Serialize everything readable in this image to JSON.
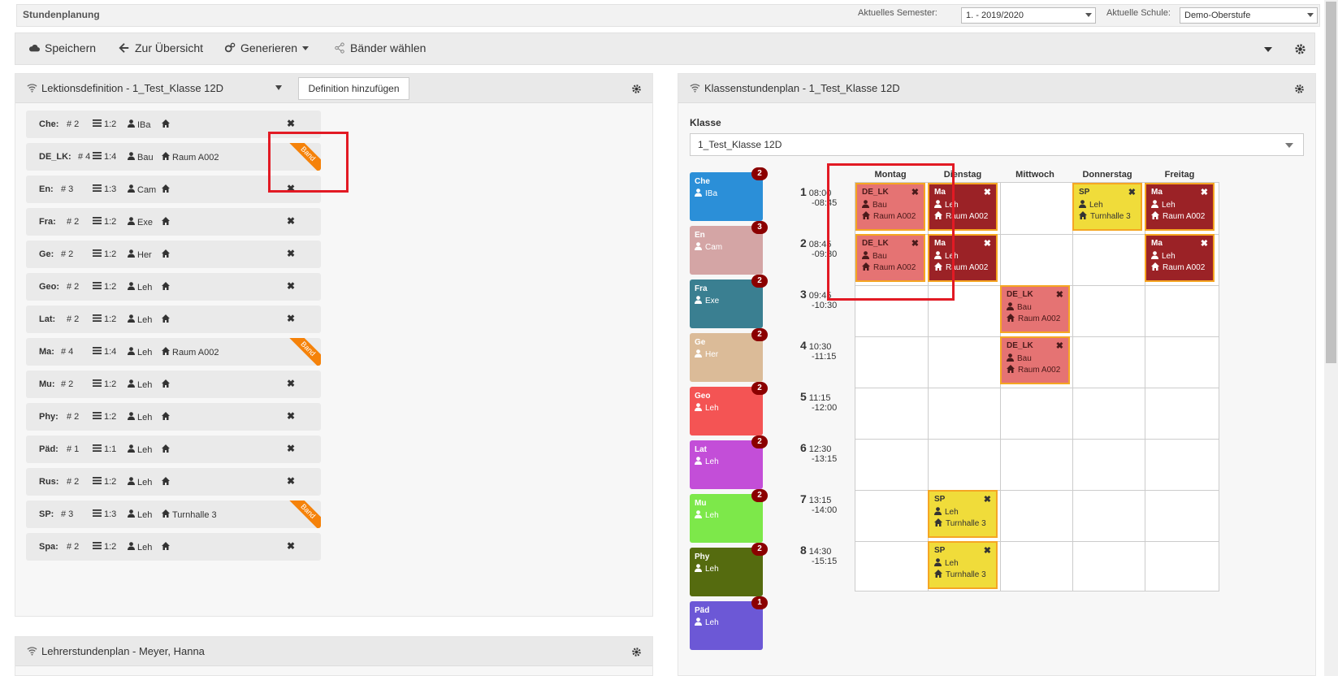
{
  "app": {
    "title": "Stundenplanung"
  },
  "header": {
    "semester_label": "Aktuelles Semester:",
    "semester_value": "1. - 2019/2020",
    "school_label": "Aktuelle Schule:",
    "school_value": "Demo-Oberstufe"
  },
  "toolbar": {
    "save_label": "Speichern",
    "back_label": "Zur Übersicht",
    "generate_label": "Generieren",
    "bands_label": "Bänder wählen"
  },
  "lessons_panel": {
    "title": "Lektionsdefinition -  1_Test_Klasse 12D",
    "add_button": "Definition hinzufügen",
    "band_label": "Band",
    "items": [
      {
        "name": "Che:",
        "count": "# 2",
        "ratio": "1:2",
        "teacher": "IBa",
        "room": "",
        "band": false
      },
      {
        "name": "DE_LK:",
        "count": "# 4",
        "ratio": "1:4",
        "teacher": "Bau",
        "room": "Raum A002",
        "band": true
      },
      {
        "name": "En:",
        "count": "# 3",
        "ratio": "1:3",
        "teacher": "Cam",
        "room": "",
        "band": false
      },
      {
        "name": "Fra:",
        "count": "# 2",
        "ratio": "1:2",
        "teacher": "Exe",
        "room": "",
        "band": false
      },
      {
        "name": "Ge:",
        "count": "# 2",
        "ratio": "1:2",
        "teacher": "Her",
        "room": "",
        "band": false
      },
      {
        "name": "Geo:",
        "count": "# 2",
        "ratio": "1:2",
        "teacher": "Leh",
        "room": "",
        "band": false
      },
      {
        "name": "Lat:",
        "count": "# 2",
        "ratio": "1:2",
        "teacher": "Leh",
        "room": "",
        "band": false
      },
      {
        "name": "Ma:",
        "count": "# 4",
        "ratio": "1:4",
        "teacher": "Leh",
        "room": "Raum A002",
        "band": true
      },
      {
        "name": "Mu:",
        "count": "# 2",
        "ratio": "1:2",
        "teacher": "Leh",
        "room": "",
        "band": false
      },
      {
        "name": "Phy:",
        "count": "# 2",
        "ratio": "1:2",
        "teacher": "Leh",
        "room": "",
        "band": false
      },
      {
        "name": "Päd:",
        "count": "# 1",
        "ratio": "1:1",
        "teacher": "Leh",
        "room": "",
        "band": false
      },
      {
        "name": "Rus:",
        "count": "# 2",
        "ratio": "1:2",
        "teacher": "Leh",
        "room": "",
        "band": false
      },
      {
        "name": "SP:",
        "count": "# 3",
        "ratio": "1:3",
        "teacher": "Leh",
        "room": "Turnhalle 3",
        "band": true
      },
      {
        "name": "Spa:",
        "count": "# 2",
        "ratio": "1:2",
        "teacher": "Leh",
        "room": "",
        "band": false
      }
    ]
  },
  "teacher_panel": {
    "title": "Lehrerstundenplan - Meyer, Hanna"
  },
  "class_panel": {
    "title": "Klassenstundenplan - 1_Test_Klasse 12D",
    "klasse_label": "Klasse",
    "klasse_value": "1_Test_Klasse 12D",
    "days": [
      "Montag",
      "Dienstag",
      "Mittwoch",
      "Donnerstag",
      "Freitag"
    ],
    "slots": [
      {
        "n": "1",
        "from": "08:00",
        "to": "-08:45"
      },
      {
        "n": "2",
        "from": "08:45",
        "to": "-09:30"
      },
      {
        "n": "3",
        "from": "09:45",
        "to": "-10:30"
      },
      {
        "n": "4",
        "from": "10:30",
        "to": "-11:15"
      },
      {
        "n": "5",
        "from": "11:15",
        "to": "-12:00"
      },
      {
        "n": "6",
        "from": "12:30",
        "to": "-13:15"
      },
      {
        "n": "7",
        "from": "13:15",
        "to": "-14:00"
      },
      {
        "n": "8",
        "from": "14:30",
        "to": "-15:15"
      }
    ],
    "pool": [
      {
        "name": "Che",
        "teacher": "IBa",
        "count": "2",
        "color": "#2b8fd8"
      },
      {
        "name": "En",
        "teacher": "Cam",
        "count": "3",
        "color": "#d4a5a5"
      },
      {
        "name": "Fra",
        "teacher": "Exe",
        "count": "2",
        "color": "#3a7f91"
      },
      {
        "name": "Ge",
        "teacher": "Her",
        "count": "2",
        "color": "#dbbb98"
      },
      {
        "name": "Geo",
        "teacher": "Leh",
        "count": "2",
        "color": "#f45454"
      },
      {
        "name": "Lat",
        "teacher": "Leh",
        "count": "2",
        "color": "#c34ed8"
      },
      {
        "name": "Mu",
        "teacher": "Leh",
        "count": "2",
        "color": "#7de84a"
      },
      {
        "name": "Phy",
        "teacher": "Leh",
        "count": "2",
        "color": "#556b0f"
      },
      {
        "name": "Päd",
        "teacher": "Leh",
        "count": "1",
        "color": "#6c58d6"
      }
    ],
    "entries": [
      {
        "day": 0,
        "slot": 0,
        "name": "DE_LK",
        "teacher": "Bau",
        "room": "Raum A002",
        "color": "#e57373",
        "text": "#4a1a1a"
      },
      {
        "day": 1,
        "slot": 0,
        "name": "Ma",
        "teacher": "Leh",
        "room": "Raum A002",
        "color": "#9b2226",
        "text": "#ffffff"
      },
      {
        "day": 3,
        "slot": 0,
        "name": "SP",
        "teacher": "Leh",
        "room": "Turnhalle 3",
        "color": "#f0dc3a",
        "text": "#333333"
      },
      {
        "day": 4,
        "slot": 0,
        "name": "Ma",
        "teacher": "Leh",
        "room": "Raum A002",
        "color": "#9b2226",
        "text": "#ffffff"
      },
      {
        "day": 0,
        "slot": 1,
        "name": "DE_LK",
        "teacher": "Bau",
        "room": "Raum A002",
        "color": "#e57373",
        "text": "#4a1a1a"
      },
      {
        "day": 1,
        "slot": 1,
        "name": "Ma",
        "teacher": "Leh",
        "room": "Raum A002",
        "color": "#9b2226",
        "text": "#ffffff"
      },
      {
        "day": 4,
        "slot": 1,
        "name": "Ma",
        "teacher": "Leh",
        "room": "Raum A002",
        "color": "#9b2226",
        "text": "#ffffff"
      },
      {
        "day": 2,
        "slot": 2,
        "name": "DE_LK",
        "teacher": "Bau",
        "room": "Raum A002",
        "color": "#e57373",
        "text": "#4a1a1a"
      },
      {
        "day": 2,
        "slot": 3,
        "name": "DE_LK",
        "teacher": "Bau",
        "room": "Raum A002",
        "color": "#e57373",
        "text": "#4a1a1a"
      },
      {
        "day": 1,
        "slot": 6,
        "name": "SP",
        "teacher": "Leh",
        "room": "Turnhalle 3",
        "color": "#f0dc3a",
        "text": "#333333"
      },
      {
        "day": 1,
        "slot": 7,
        "name": "SP",
        "teacher": "Leh",
        "room": "Turnhalle 3",
        "color": "#f0dc3a",
        "text": "#333333"
      }
    ]
  },
  "colors": {
    "band": "#f5820a",
    "highlight": "#e21a24",
    "badge": "#8b0000"
  }
}
